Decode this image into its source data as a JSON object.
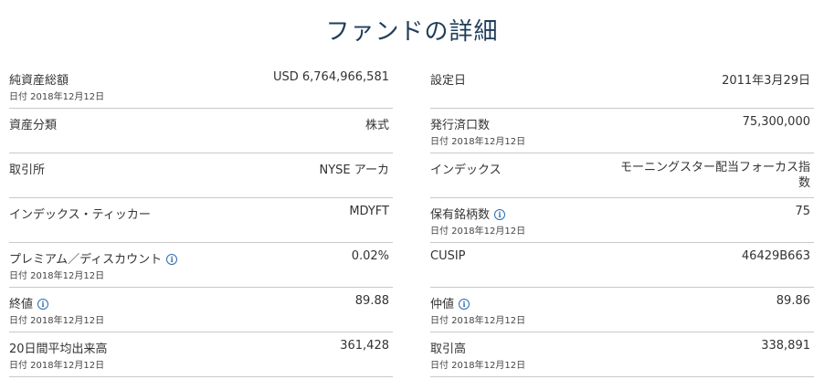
{
  "title": "ファンドの詳細",
  "left": [
    {
      "label": "純資産総額",
      "value": "USD 6,764,966,581",
      "date": "日付 2018年12月12日",
      "info": false
    },
    {
      "label": "資産分類",
      "value": "株式",
      "date": "",
      "info": false
    },
    {
      "label": "取引所",
      "value": "NYSE アーカ",
      "date": "",
      "info": false
    },
    {
      "label": "インデックス・ティッカー",
      "value": "MDYFT",
      "date": "",
      "info": false
    },
    {
      "label": "プレミアム／ディスカウント",
      "value": "0.02%",
      "date": "日付 2018年12月12日",
      "info": true
    },
    {
      "label": "終値",
      "value": "89.88",
      "date": "日付 2018年12月12日",
      "info": true
    },
    {
      "label": "20日間平均出来高",
      "value": "361,428",
      "date": "日付 2018年12月12日",
      "info": false
    }
  ],
  "right": [
    {
      "label": "設定日",
      "value": "2011年3月29日",
      "date": "",
      "info": false
    },
    {
      "label": "発行済口数",
      "value": "75,300,000",
      "date": "日付 2018年12月12日",
      "info": false
    },
    {
      "label": "インデックス",
      "value": "モーニングスター配当フォーカス指数",
      "date": "",
      "info": false
    },
    {
      "label": "保有銘柄数",
      "value": "75",
      "date": "日付 2018年12月12日",
      "info": true
    },
    {
      "label": "CUSIP",
      "value": "46429B663",
      "date": "",
      "info": false
    },
    {
      "label": "仲値",
      "value": "89.86",
      "date": "日付 2018年12月12日",
      "info": true
    },
    {
      "label": "取引高",
      "value": "338,891",
      "date": "日付 2018年12月12日",
      "info": false
    }
  ],
  "info_icon": {
    "icon": "info-icon",
    "glyph": "i",
    "color": "#2b6cb0"
  }
}
